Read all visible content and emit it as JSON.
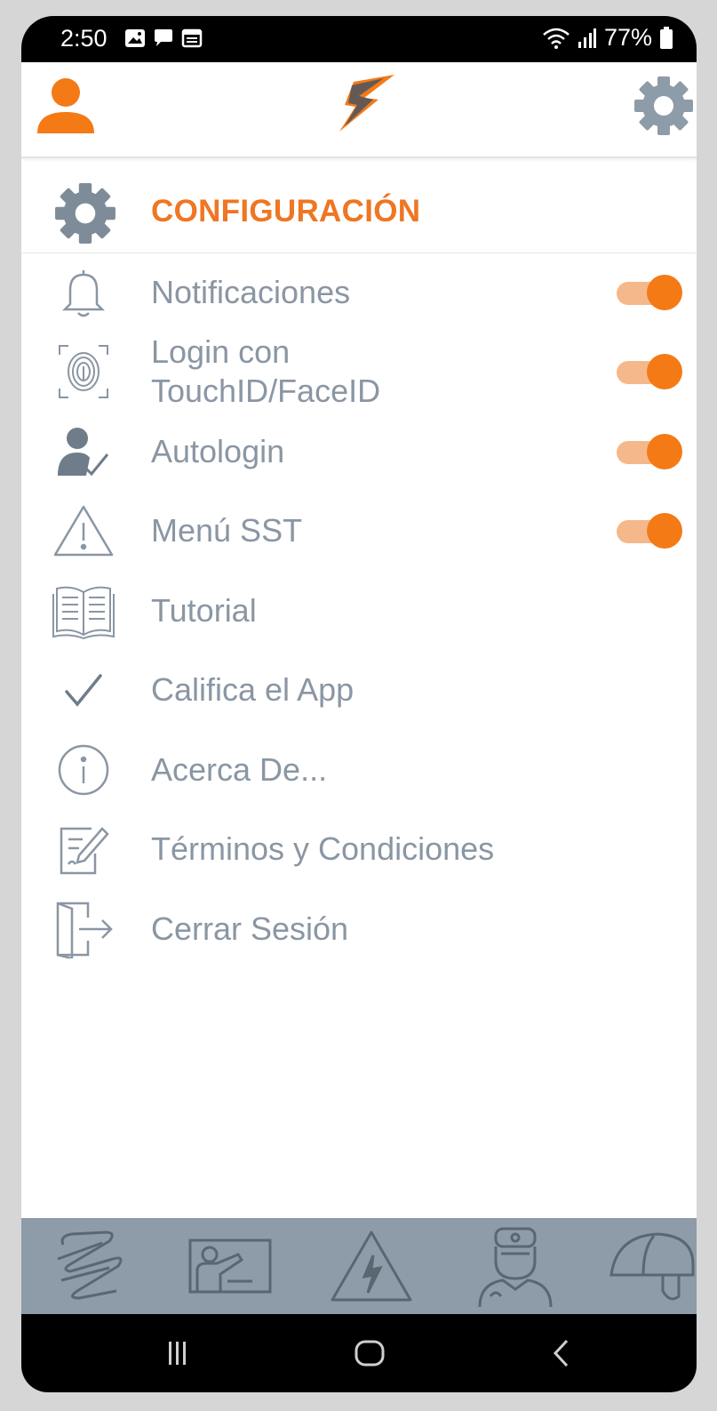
{
  "status_bar": {
    "time": "2:50",
    "battery": "77%"
  },
  "header": {
    "user_icon": "user-icon",
    "logo_icon": "app-logo-icon",
    "settings_icon": "gear-icon"
  },
  "section": {
    "title": "CONFIGURACIÓN",
    "icon": "gear-icon"
  },
  "menu": {
    "items": [
      {
        "label": "Notificaciones",
        "icon": "bell-icon",
        "toggle": true,
        "on": true
      },
      {
        "label": "Login con\nTouchID/FaceID",
        "icon": "fingerprint-icon",
        "toggle": true,
        "on": true
      },
      {
        "label": "Autologin",
        "icon": "user-check-icon",
        "toggle": true,
        "on": true
      },
      {
        "label": "Menú SST",
        "icon": "warning-icon",
        "toggle": true,
        "on": true
      },
      {
        "label": "Tutorial",
        "icon": "book-icon",
        "toggle": false
      },
      {
        "label": "Califica el App",
        "icon": "checkmark-icon",
        "toggle": false
      },
      {
        "label": "Acerca De...",
        "icon": "info-icon",
        "toggle": false
      },
      {
        "label": "Términos y Condiciones",
        "icon": "document-edit-icon",
        "toggle": false
      },
      {
        "label": "Cerrar Sesión",
        "icon": "logout-icon",
        "toggle": false
      }
    ]
  },
  "tabbar": {
    "tabs": [
      "brand-pattern-icon",
      "presentation-icon",
      "electric-hazard-icon",
      "worker-icon",
      "hard-hat-icon"
    ]
  },
  "colors": {
    "accent": "#ef7622",
    "text": "#8a96a3",
    "tabbar": "#8e9ba8"
  }
}
